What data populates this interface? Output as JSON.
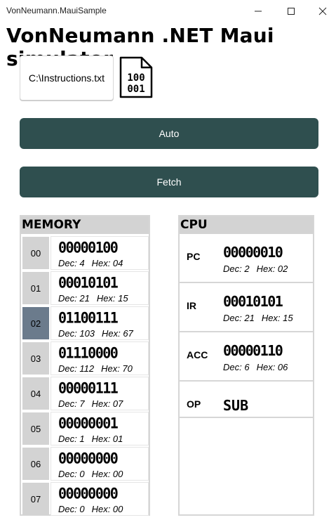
{
  "window": {
    "title": "VonNeumann.MauiSample",
    "controls": [
      "minimize",
      "maximize",
      "close"
    ]
  },
  "app": {
    "title": "VonNeumann .NET Maui simulator"
  },
  "file": {
    "path": "C:\\Instructions.txt",
    "icon_lines": [
      "100",
      "001"
    ]
  },
  "buttons": {
    "auto": "Auto",
    "fetch": "Fetch"
  },
  "memory": {
    "header": "MEMORY",
    "active_address": "02",
    "rows": [
      {
        "address": "00",
        "bits": "00000100",
        "dec": "Dec: 4",
        "hex": "Hex: 04"
      },
      {
        "address": "01",
        "bits": "00010101",
        "dec": "Dec: 21",
        "hex": "Hex: 15"
      },
      {
        "address": "02",
        "bits": "01100111",
        "dec": "Dec: 103",
        "hex": "Hex: 67"
      },
      {
        "address": "03",
        "bits": "01110000",
        "dec": "Dec: 112",
        "hex": "Hex: 70"
      },
      {
        "address": "04",
        "bits": "00000111",
        "dec": "Dec: 7",
        "hex": "Hex: 07"
      },
      {
        "address": "05",
        "bits": "00000001",
        "dec": "Dec: 1",
        "hex": "Hex: 01"
      },
      {
        "address": "06",
        "bits": "00000000",
        "dec": "Dec: 0",
        "hex": "Hex: 00"
      },
      {
        "address": "07",
        "bits": "00000000",
        "dec": "Dec: 0",
        "hex": "Hex: 00"
      }
    ]
  },
  "cpu": {
    "header": "CPU",
    "registers": [
      {
        "name": "PC",
        "bits": "00000010",
        "dec": "Dec: 2",
        "hex": "Hex: 02"
      },
      {
        "name": "IR",
        "bits": "00010101",
        "dec": "Dec: 21",
        "hex": "Hex: 15"
      },
      {
        "name": "ACC",
        "bits": "00000110",
        "dec": "Dec: 6",
        "hex": "Hex: 06"
      }
    ],
    "op": {
      "name": "OP",
      "value": "SUB"
    }
  },
  "colors": {
    "button_bg": "#2f4f4f",
    "header_bg": "#d3d3d3",
    "active_address_bg": "#6b7b8c"
  }
}
